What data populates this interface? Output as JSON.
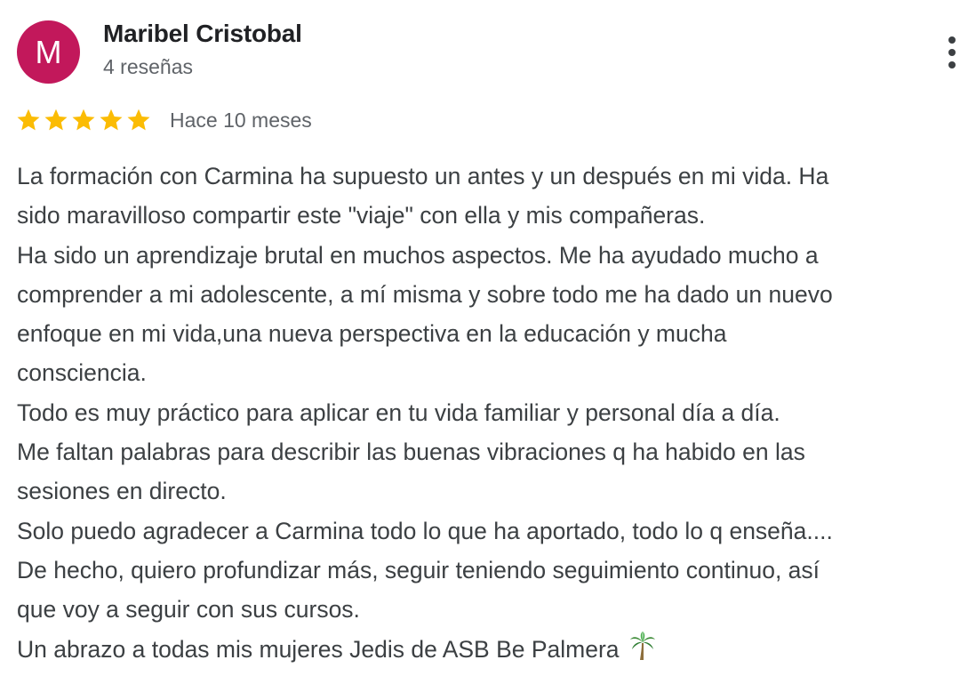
{
  "review": {
    "author": {
      "initial": "M",
      "name": "Maribel Cristobal",
      "review_count": "4 reseñas",
      "avatar_color": "#c2185b"
    },
    "menu_icon": "more-vert-icon",
    "rating": {
      "stars": 5,
      "max": 5,
      "star_color": "#fbbc04"
    },
    "date": "Hace 10 meses",
    "text_lines": [
      "La formación con Carmina ha supuesto un antes y un después en mi vida. Ha",
      "sido maravilloso compartir este \"viaje\" con ella y mis compañeras.",
      "Ha sido un aprendizaje brutal en muchos aspectos. Me ha ayudado mucho a",
      "comprender a mi adolescente, a mí misma y sobre todo me ha dado un nuevo",
      "enfoque en mi vida,una nueva perspectiva en la educación y mucha",
      "consciencia.",
      "Todo es muy práctico para aplicar en tu vida familiar y personal día a día.",
      "Me faltan palabras para describir las buenas vibraciones q ha habido en las",
      "sesiones en directo.",
      "Solo puedo agradecer a Carmina todo lo que ha aportado, todo lo q enseña....",
      "De hecho, quiero profundizar más, seguir teniendo seguimiento continuo, así",
      "que voy a seguir con sus cursos.",
      "Un abrazo a todas mis mujeres Jedis de ASB Be Palmera"
    ],
    "trailing_emoji": "palm-tree-icon"
  }
}
